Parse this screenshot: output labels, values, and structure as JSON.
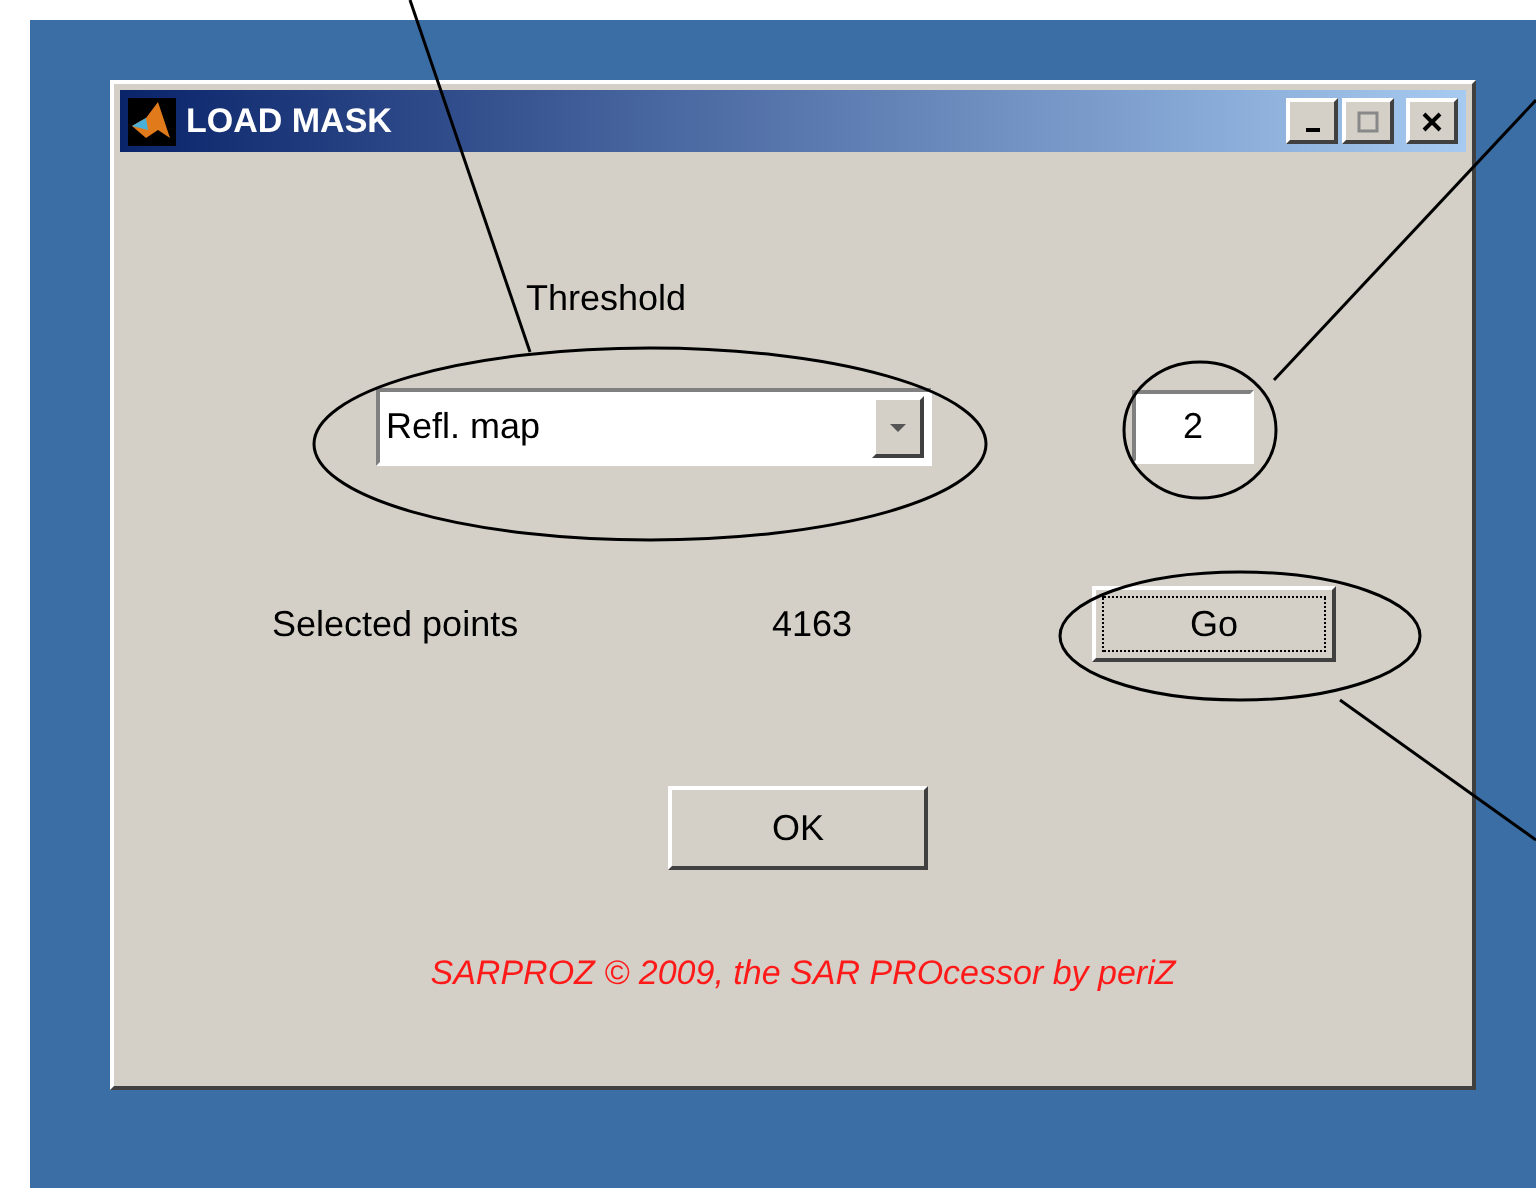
{
  "window": {
    "title": "LOAD MASK"
  },
  "threshold": {
    "label": "Threshold",
    "dropdown_value": "Refl. map",
    "value": "2"
  },
  "selected_points": {
    "label": "Selected points",
    "value": "4163"
  },
  "buttons": [
    {
      "label": "Go",
      "kind": "go",
      "focused": true
    },
    {
      "label": "OK",
      "kind": "ok",
      "focused": false
    }
  ],
  "footer": "SARPROZ © 2009, the SAR PROcessor by periZ"
}
